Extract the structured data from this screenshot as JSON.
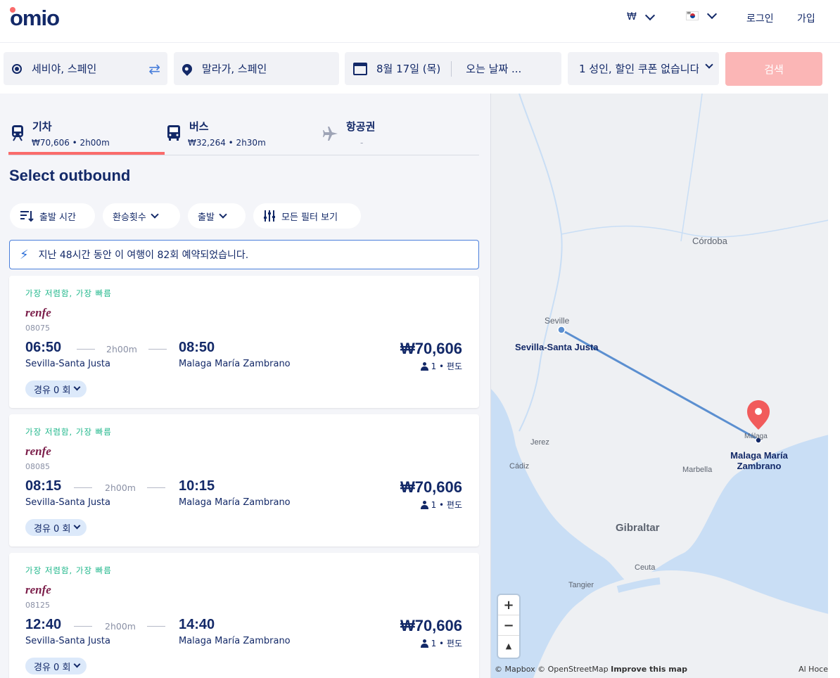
{
  "header": {
    "logo": "omio",
    "currency": "₩",
    "login": "로그인",
    "signup": "가입"
  },
  "search": {
    "origin": "세비야, 스페인",
    "destination": "말라가, 스페인",
    "depart_date": "8월 17일 (목)",
    "return_date": "오는 날짜 ...",
    "passengers": "1 성인, 할인 쿠폰 없습니다",
    "search_button": "검색"
  },
  "tabs": [
    {
      "label": "기차",
      "sub": "₩70,606 • 2h00m"
    },
    {
      "label": "버스",
      "sub": "₩32,264 • 2h30m"
    },
    {
      "label": "항공권",
      "sub": "-"
    }
  ],
  "heading": "Select outbound",
  "filters": {
    "departure_time": "출발 시간",
    "transfers": "환승횟수",
    "depart": "출발",
    "all_filters": "모든 필터 보기"
  },
  "banner": "지난 48시간 동안 이 여행이 82회 예약되었습니다.",
  "results": [
    {
      "tag": "가장 저렴함, 가장 빠름",
      "brand": "renfe",
      "train_no": "08075",
      "dep_time": "06:50",
      "arr_time": "08:50",
      "duration": "2h00m",
      "from": "Sevilla-Santa Justa",
      "to": "Malaga María Zambrano",
      "price": "₩70,606",
      "pax": "1 • 편도",
      "stops": "경유 0 회"
    },
    {
      "tag": "가장 저렴함, 가장 빠름",
      "brand": "renfe",
      "train_no": "08085",
      "dep_time": "08:15",
      "arr_time": "10:15",
      "duration": "2h00m",
      "from": "Sevilla-Santa Justa",
      "to": "Malaga María Zambrano",
      "price": "₩70,606",
      "pax": "1 • 편도",
      "stops": "경유 0 회"
    },
    {
      "tag": "가장 저렴함, 가장 빠름",
      "brand": "renfe",
      "train_no": "08125",
      "dep_time": "12:40",
      "arr_time": "14:40",
      "duration": "2h00m",
      "from": "Sevilla-Santa Justa",
      "to": "Malaga María Zambrano",
      "price": "₩70,606",
      "pax": "1 • 편도",
      "stops": "경유 0 회"
    }
  ],
  "map": {
    "labels": {
      "cordoba": "Córdoba",
      "seville": "Seville",
      "jerez": "Jerez",
      "cadiz": "Cádiz",
      "marbella": "Marbella",
      "gibraltar": "Gibraltar",
      "ceuta": "Ceuta",
      "tangier": "Tangier",
      "malaga": "Málaga"
    },
    "origin_station": "Sevilla-Santa Justa",
    "destination_station": "Malaga María Zambrano",
    "zoom_in": "+",
    "zoom_out": "−",
    "compass": "▲",
    "attribution_mapbox": "© Mapbox",
    "attribution_osm": "© OpenStreetMap",
    "improve": "Improve this map",
    "attribution_right": "Al Hoce"
  },
  "colors": {
    "brand_navy": "#132968",
    "accent_coral": "#fa6b6b",
    "tag_green": "#1fb78b",
    "route_blue": "#5b8fd0"
  }
}
